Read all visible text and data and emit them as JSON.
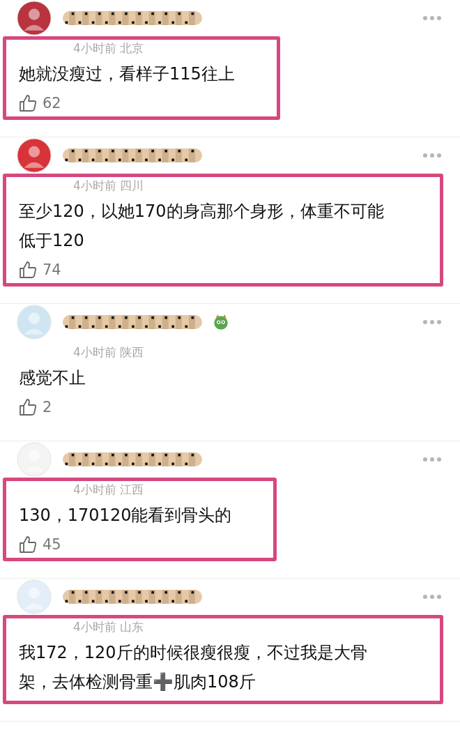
{
  "comments": [
    {
      "highlighted": true,
      "badge": false,
      "meta": "4小时前 北京",
      "text": "她就没瘦过，看样子115往上",
      "likes": "62"
    },
    {
      "highlighted": true,
      "badge": false,
      "meta": "4小时前 四川",
      "text": "至少120，以她170的身高那个身形，体重不可能低于120",
      "likes": "74"
    },
    {
      "highlighted": false,
      "badge": true,
      "meta": "4小时前 陕西",
      "text": "感觉不止",
      "likes": "2"
    },
    {
      "highlighted": true,
      "badge": false,
      "meta": "4小时前 江西",
      "text": "130，170120能看到骨头的",
      "likes": "45"
    },
    {
      "highlighted": true,
      "badge": false,
      "meta": "4小时前 山东",
      "text": "我172，120斤的时候很瘦很瘦，不过我是大骨架，去体检测骨重➕肌肉108斤"
    }
  ]
}
